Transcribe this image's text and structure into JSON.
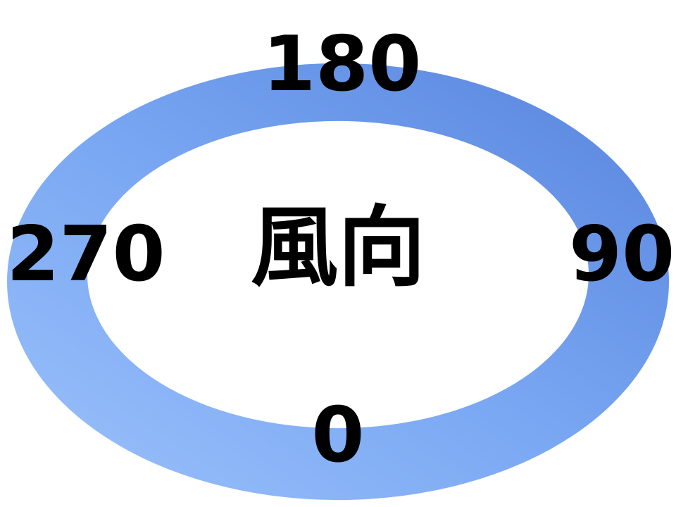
{
  "diagram": {
    "center_label": "風向",
    "directions": {
      "top": "180",
      "right": "90",
      "bottom": "0",
      "left": "270"
    },
    "colors": {
      "ring_light": "#9cc2fb",
      "ring_mid": "#78a6f2",
      "ring_dark": "#5683dc",
      "text": "#000000",
      "background": "#ffffff"
    }
  }
}
